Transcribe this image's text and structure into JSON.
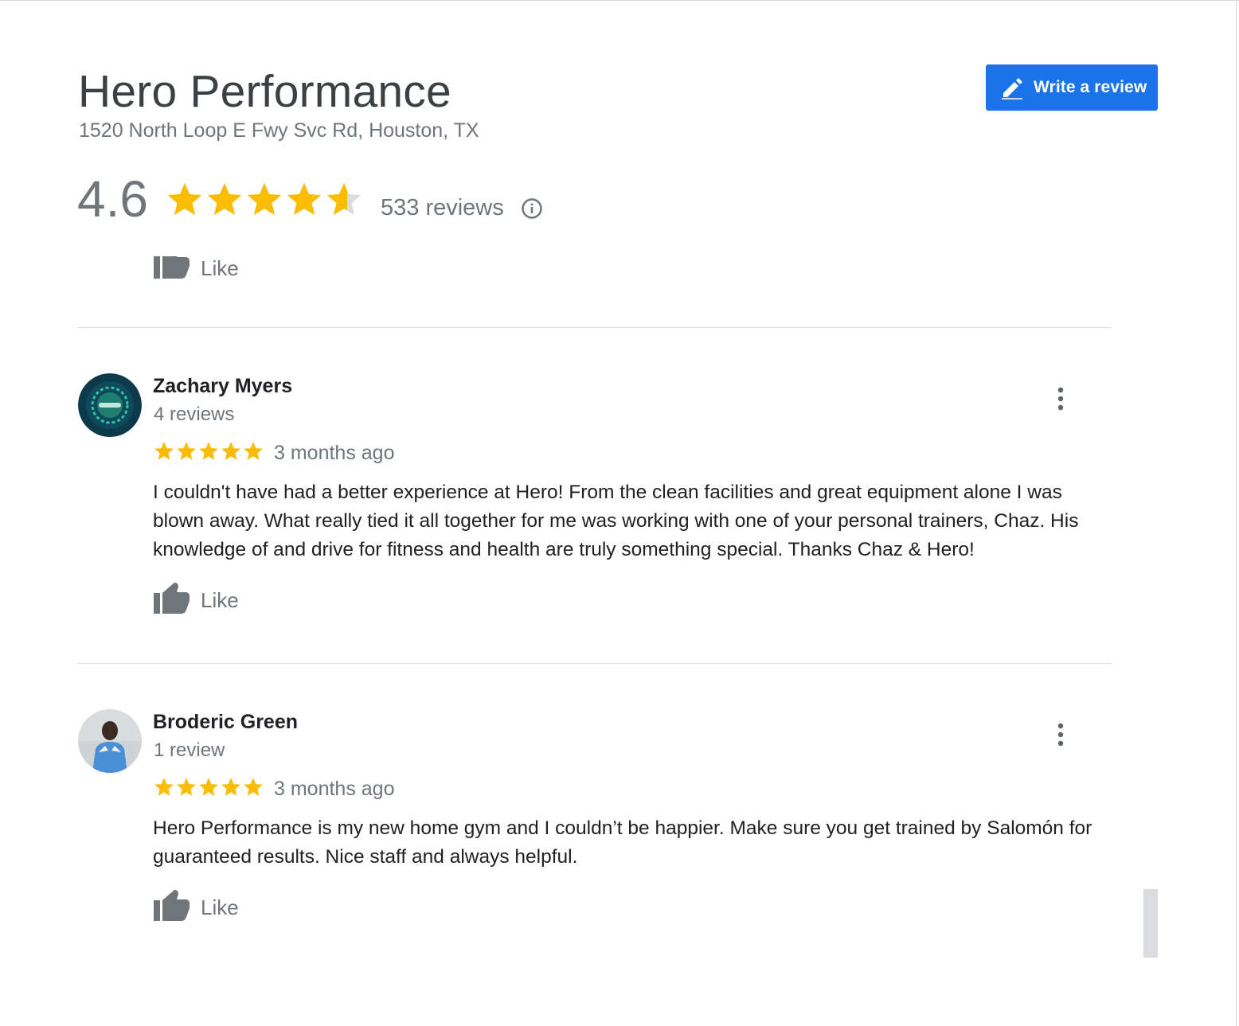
{
  "business": {
    "name": "Hero Performance",
    "address": "1520 North Loop E Fwy Svc Rd, Houston, TX",
    "rating": "4.6",
    "rating_fraction": 0.92,
    "review_count": "533 reviews"
  },
  "actions": {
    "write_review": "Write a review",
    "like_label": "Like"
  },
  "reviews": [
    {
      "name": "Zachary Myers",
      "meta": "4 reviews",
      "stars": 5,
      "date": "3 months ago",
      "text": "I couldn't have had a better experience at Hero! From the clean facilities and great equipment alone I was blown away. What really tied it all together for me was working with one of your personal trainers, Chaz. His knowledge of and drive for fitness and health are truly something special. Thanks Chaz & Hero!",
      "like_label": "Like"
    },
    {
      "name": "Broderic Green",
      "meta": "1 review",
      "stars": 5,
      "date": "3 months ago",
      "text": "Hero Performance is my new home gym and I couldn’t be happier. Make sure you get trained by Salomón for guaranteed results. Nice staff and always helpful.",
      "like_label": "Like"
    }
  ],
  "colors": {
    "accent": "#1a73e8",
    "star": "#fbbc04",
    "star_empty": "#dadce0",
    "muted_text": "#70757a",
    "icon_gray": "#70757a"
  },
  "icons": {
    "write": "pencil-icon",
    "info": "info-icon",
    "like": "thumbs-up-icon",
    "menu": "more-vert-icon",
    "star": "star-icon"
  }
}
